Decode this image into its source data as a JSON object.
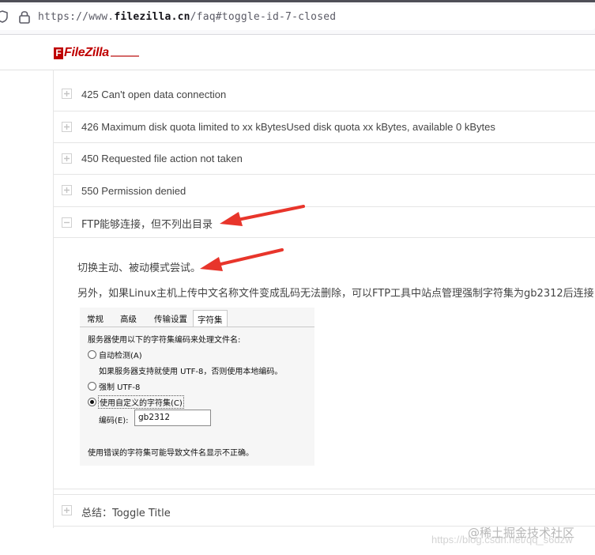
{
  "browser": {
    "url_prefix": "https://www.",
    "url_domain": "filezilla.cn",
    "url_path": "/faq#toggle-id-7-closed"
  },
  "site": {
    "logo_letter": "F",
    "logo_text": "FileZilla"
  },
  "toggles": [
    {
      "title": "425 Can't open data connection",
      "state": "collapsed"
    },
    {
      "title": "426 Maximum disk quota limited to xx kBytesUsed disk quota xx kBytes, available 0 kBytes",
      "state": "collapsed"
    },
    {
      "title": "450 Requested file action not taken",
      "state": "collapsed"
    },
    {
      "title": "550 Permission denied",
      "state": "collapsed"
    },
    {
      "title": "FTP能够连接，但不列出目录",
      "state": "expanded"
    },
    {
      "title": "总结：Toggle Title",
      "state": "collapsed"
    }
  ],
  "answer": {
    "line1": "切换主动、被动模式尝试。",
    "line2": "另外，如果Linux主机上传中文名称文件变成乱码无法删除，可以FTP工具中站点管理强制字符集为gb2312后连接："
  },
  "dialog": {
    "tabs": [
      "常规",
      "高级",
      "传输设置",
      "字符集"
    ],
    "active_tab": "字符集",
    "intro": "服务器使用以下的字符集编码来处理文件名:",
    "option_auto": "自动检测(A)",
    "option_auto_note": "如果服务器支持就使用 UTF-8，否则使用本地编码。",
    "option_utf8": "强制 UTF-8",
    "option_custom": "使用自定义的字符集(C)",
    "selected_option": "custom",
    "encoding_label": "编码(E):",
    "encoding_value": "gb2312",
    "warning": "使用错误的字符集可能导致文件名显示不正确。"
  },
  "watermark": {
    "line1": "@稀土掘金技术社区",
    "line2": "https://blog.csdn.net/qq_s6dzw"
  },
  "colors": {
    "brand_red": "#bf0000",
    "arrow_red": "#e8352b",
    "border": "#e5e5e5",
    "text": "#444444"
  }
}
